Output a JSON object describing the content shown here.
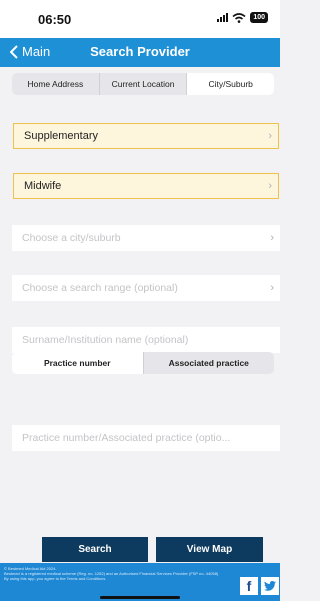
{
  "status": {
    "time": "06:50",
    "battery": "100"
  },
  "nav": {
    "back_label": "Main",
    "title": "Search Provider"
  },
  "tabs": [
    {
      "label": "Home Address",
      "active": false
    },
    {
      "label": "Current Location",
      "active": false
    },
    {
      "label": "City/Suburb",
      "active": true
    }
  ],
  "rows": {
    "supplementary": "Supplementary",
    "midwife": "Midwife",
    "city": "Choose a city/suburb",
    "range": "Choose a search range (optional)"
  },
  "inputs": {
    "surname_placeholder": "Surname/Institution name (optional)",
    "practice_placeholder": "Practice number/Associated practice (optio..."
  },
  "practice_toggle": [
    {
      "label": "Practice number",
      "active": true
    },
    {
      "label": "Associated practice",
      "active": false
    }
  ],
  "buttons": {
    "search": "Search",
    "view_map": "View Map"
  },
  "footer": {
    "line1": "© Bestmed Medical Aid 2024.",
    "line2": "Bestmed is a registered medical scheme (Reg. no. 1252) and an Authorised Financial Services Provider (FSP no. 44058)",
    "line3": "By using this app, you agree to the Terms and Conditions",
    "facebook": "f",
    "twitter": "t"
  },
  "colors": {
    "nav": "#1e90d6",
    "button": "#0d3b60",
    "footer": "#1e88d4",
    "highlight_border": "#f0c14b"
  }
}
